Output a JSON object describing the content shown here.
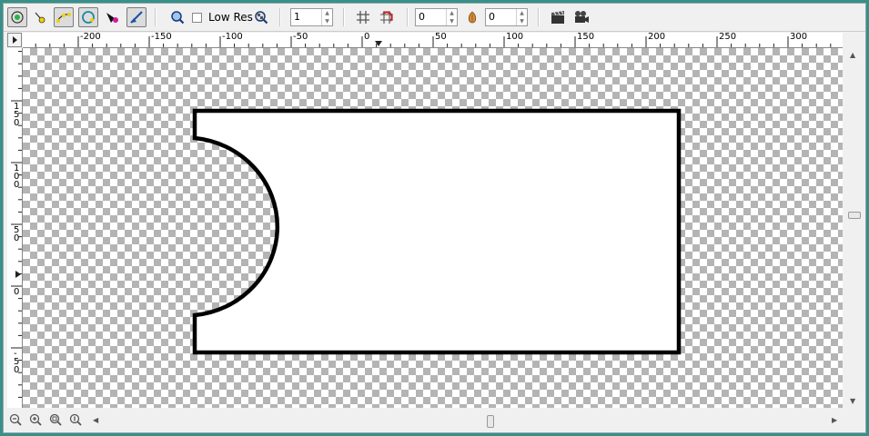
{
  "toolbar": {
    "tools": [
      {
        "name": "transform-tool-icon",
        "pressed": true
      },
      {
        "name": "smooth-move-tool-icon",
        "pressed": false
      },
      {
        "name": "spline-tool-icon",
        "pressed": true
      },
      {
        "name": "circle-tool-icon",
        "pressed": false
      },
      {
        "name": "fill-tool-icon",
        "pressed": false
      },
      {
        "name": "draw-tool-icon",
        "pressed": true
      }
    ],
    "low_res_label": "Low Res",
    "low_res_checked": false,
    "past_keyframes": "1",
    "onion_past": "0",
    "onion_future": "0"
  },
  "ruler": {
    "h_labels": [
      "-200",
      "-150",
      "-100",
      "-50",
      "0",
      "50",
      "100",
      "150",
      "200",
      "250",
      "300"
    ],
    "v_labels": [
      "150",
      "100",
      "50",
      "0",
      "-50"
    ]
  },
  "zoom_buttons": [
    "zoom-out-icon",
    "zoom-in-icon",
    "zoom-fit-icon",
    "zoom-100-icon"
  ],
  "colors": {
    "canvas_checker_dark": "#b4b4b4",
    "canvas_checker_light": "#ffffff",
    "shape_fill": "#ffffff",
    "shape_outline": "#000000",
    "frame_border": "#3a8f88"
  }
}
